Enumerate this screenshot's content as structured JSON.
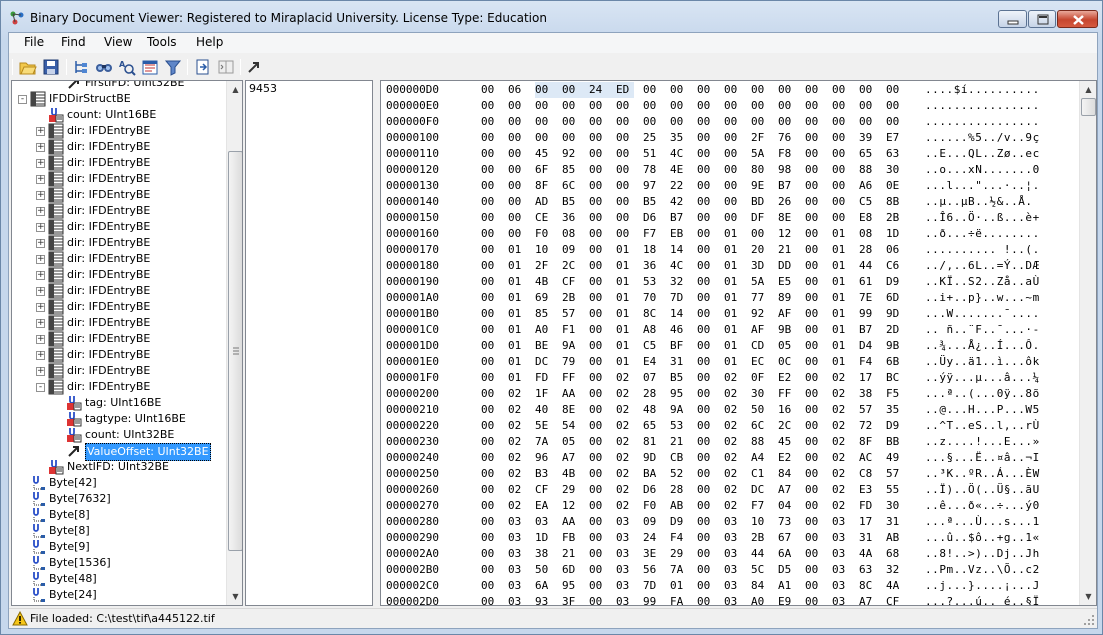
{
  "window": {
    "title": "Binary Document Viewer: Registered to Miraplacid University. License Type: Education"
  },
  "menu": [
    "File",
    "Find",
    "View",
    "Tools",
    "Help"
  ],
  "toolbar": {
    "icons": [
      "open-folder-icon",
      "save-icon",
      "tree-structure-icon",
      "find-icon",
      "find-next-icon",
      "properties-icon",
      "filter-icon",
      "export-icon",
      "panel-toggle-icon",
      "go-to-icon"
    ]
  },
  "tree": {
    "items": [
      {
        "label": "FirstIFD: UInt32BE",
        "icon": "arrow-pointer-icon",
        "expander": ""
      },
      {
        "label": "IFDDirStructBE",
        "icon": "struct-icon",
        "expander": "-"
      },
      {
        "label": "count: UInt16BE",
        "icon": "field-icon",
        "expander": ""
      },
      {
        "label": "dir: IFDEntryBE",
        "icon": "struct-icon",
        "expander": "+"
      },
      {
        "label": "dir: IFDEntryBE",
        "icon": "struct-icon",
        "expander": "+"
      },
      {
        "label": "dir: IFDEntryBE",
        "icon": "struct-icon",
        "expander": "+"
      },
      {
        "label": "dir: IFDEntryBE",
        "icon": "struct-icon",
        "expander": "+"
      },
      {
        "label": "dir: IFDEntryBE",
        "icon": "struct-icon",
        "expander": "+"
      },
      {
        "label": "dir: IFDEntryBE",
        "icon": "struct-icon",
        "expander": "+"
      },
      {
        "label": "dir: IFDEntryBE",
        "icon": "struct-icon",
        "expander": "+"
      },
      {
        "label": "dir: IFDEntryBE",
        "icon": "struct-icon",
        "expander": "+"
      },
      {
        "label": "dir: IFDEntryBE",
        "icon": "struct-icon",
        "expander": "+"
      },
      {
        "label": "dir: IFDEntryBE",
        "icon": "struct-icon",
        "expander": "+"
      },
      {
        "label": "dir: IFDEntryBE",
        "icon": "struct-icon",
        "expander": "+"
      },
      {
        "label": "dir: IFDEntryBE",
        "icon": "struct-icon",
        "expander": "+"
      },
      {
        "label": "dir: IFDEntryBE",
        "icon": "struct-icon",
        "expander": "+"
      },
      {
        "label": "dir: IFDEntryBE",
        "icon": "struct-icon",
        "expander": "+"
      },
      {
        "label": "dir: IFDEntryBE",
        "icon": "struct-icon",
        "expander": "+"
      },
      {
        "label": "dir: IFDEntryBE",
        "icon": "struct-icon",
        "expander": "+"
      },
      {
        "label": "dir: IFDEntryBE",
        "icon": "struct-icon",
        "expander": "-"
      },
      {
        "label": "tag: UInt16BE",
        "icon": "field-icon",
        "expander": ""
      },
      {
        "label": "tagtype: UInt16BE",
        "icon": "field-icon",
        "expander": ""
      },
      {
        "label": "count: UInt32BE",
        "icon": "field-icon",
        "expander": ""
      },
      {
        "label": "ValueOffset: UInt32BE",
        "icon": "arrow-pointer-icon",
        "expander": "",
        "selected": true
      },
      {
        "label": "NextIFD: UInt32BE",
        "icon": "field-icon",
        "expander": ""
      },
      {
        "label": "Byte[42]",
        "icon": "array-icon",
        "expander": ""
      },
      {
        "label": "Byte[7632]",
        "icon": "array-icon",
        "expander": ""
      },
      {
        "label": "Byte[8]",
        "icon": "array-icon",
        "expander": ""
      },
      {
        "label": "Byte[8]",
        "icon": "array-icon",
        "expander": ""
      },
      {
        "label": "Byte[9]",
        "icon": "array-icon",
        "expander": ""
      },
      {
        "label": "Byte[1536]",
        "icon": "array-icon",
        "expander": ""
      },
      {
        "label": "Byte[48]",
        "icon": "array-icon",
        "expander": ""
      },
      {
        "label": "Byte[24]",
        "icon": "array-icon",
        "expander": ""
      }
    ]
  },
  "value_pane": {
    "value": "9453"
  },
  "hex": {
    "highlight": {
      "row": 0,
      "bytes": [
        2,
        3,
        4,
        5
      ]
    },
    "rows": [
      {
        "addr": "000000D0",
        "bytes": "00 06 00 00 24 ED 00 00 00 00 00 00 00 00 00 00",
        "ascii": "....$í.........."
      },
      {
        "addr": "000000E0",
        "bytes": "00 00 00 00 00 00 00 00 00 00 00 00 00 00 00 00",
        "ascii": "................"
      },
      {
        "addr": "000000F0",
        "bytes": "00 00 00 00 00 00 00 00 00 00 00 00 00 00 00 00",
        "ascii": "................"
      },
      {
        "addr": "00000100",
        "bytes": "00 00 00 00 00 00 25 35 00 00 2F 76 00 00 39 E7",
        "ascii": "......%5../v..9ç"
      },
      {
        "addr": "00000110",
        "bytes": "00 00 45 92 00 00 51 4C 00 00 5A F8 00 00 65 63",
        "ascii": "..E...QL..Zø..ec"
      },
      {
        "addr": "00000120",
        "bytes": "00 00 6F 85 00 00 78 4E 00 00 80 98 00 00 88 30",
        "ascii": "..o...xN.......0"
      },
      {
        "addr": "00000130",
        "bytes": "00 00 8F 6C 00 00 97 22 00 00 9E B7 00 00 A6 0E",
        "ascii": "...l...\"...·..¦."
      },
      {
        "addr": "00000140",
        "bytes": "00 00 AD B5 00 00 B5 42 00 00 BD 26 00 00 C5 8B",
        "ascii": "..­µ..µB..½&..Å."
      },
      {
        "addr": "00000150",
        "bytes": "00 00 CE 36 00 00 D6 B7 00 00 DF 8E 00 00 E8 2B",
        "ascii": "..Î6..Ö·..ß...è+"
      },
      {
        "addr": "00000160",
        "bytes": "00 00 F0 08 00 00 F7 EB 00 01 00 12 00 01 08 1D",
        "ascii": "..ð...÷ë........"
      },
      {
        "addr": "00000170",
        "bytes": "00 01 10 09 00 01 18 14 00 01 20 21 00 01 28 06",
        "ascii": ".......... !..(."
      },
      {
        "addr": "00000180",
        "bytes": "00 01 2F 2C 00 01 36 4C 00 01 3D DD 00 01 44 C6",
        "ascii": "../,..6L..=Ý..DÆ"
      },
      {
        "addr": "00000190",
        "bytes": "00 01 4B CF 00 01 53 32 00 01 5A E5 00 01 61 D9",
        "ascii": "..KÏ..S2..Zå..aÙ"
      },
      {
        "addr": "000001A0",
        "bytes": "00 01 69 2B 00 01 70 7D 00 01 77 89 00 01 7E 6D",
        "ascii": "..i+..p}..w...~m"
      },
      {
        "addr": "000001B0",
        "bytes": "00 01 85 57 00 01 8C 14 00 01 92 AF 00 01 99 9D",
        "ascii": "...W.......¯...."
      },
      {
        "addr": "000001C0",
        "bytes": "00 01 A0 F1 00 01 A8 46 00 01 AF 9B 00 01 B7 2D",
        "ascii": ".. ñ..¨F..¯...·-"
      },
      {
        "addr": "000001D0",
        "bytes": "00 01 BE 9A 00 01 C5 BF 00 01 CD 05 00 01 D4 9B",
        "ascii": "..¾...Å¿..Í...Ô."
      },
      {
        "addr": "000001E0",
        "bytes": "00 01 DC 79 00 01 E4 31 00 01 EC 0C 00 01 F4 6B",
        "ascii": "..Üy..ä1..ì...ôk"
      },
      {
        "addr": "000001F0",
        "bytes": "00 01 FD FF 00 02 07 B5 00 02 0F E2 00 02 17 BC",
        "ascii": "..ýÿ...µ...â...¼"
      },
      {
        "addr": "00000200",
        "bytes": "00 02 1F AA 00 02 28 95 00 02 30 FF 00 02 38 F5",
        "ascii": "...ª..(...0ÿ..8õ"
      },
      {
        "addr": "00000210",
        "bytes": "00 02 40 8E 00 02 48 9A 00 02 50 16 00 02 57 35",
        "ascii": "..@...H...P...W5"
      },
      {
        "addr": "00000220",
        "bytes": "00 02 5E 54 00 02 65 53 00 02 6C 2C 00 02 72 D9",
        "ascii": "..^T..eS..l,..rÙ"
      },
      {
        "addr": "00000230",
        "bytes": "00 02 7A 05 00 02 81 21 00 02 88 45 00 02 8F BB",
        "ascii": "..z....!...E...»"
      },
      {
        "addr": "00000240",
        "bytes": "00 02 96 A7 00 02 9D CB 00 02 A4 E2 00 02 AC 49",
        "ascii": "...§...Ë..¤â..¬I"
      },
      {
        "addr": "00000250",
        "bytes": "00 02 B3 4B 00 02 BA 52 00 02 C1 84 00 02 C8 57",
        "ascii": "..³K..ºR..Á...ÈW"
      },
      {
        "addr": "00000260",
        "bytes": "00 02 CF 29 00 02 D6 28 00 02 DC A7 00 02 E3 55",
        "ascii": "..Ï)..Ö(..Ü§..ãU"
      },
      {
        "addr": "00000270",
        "bytes": "00 02 EA 12 00 02 F0 AB 00 02 F7 04 00 02 FD 30",
        "ascii": "..ê...ð«..÷...ý0"
      },
      {
        "addr": "00000280",
        "bytes": "00 03 03 AA 00 03 09 D9 00 03 10 73 00 03 17 31",
        "ascii": "...ª...Ù...s...1"
      },
      {
        "addr": "00000290",
        "bytes": "00 03 1D FB 00 03 24 F4 00 03 2B 67 00 03 31 AB",
        "ascii": "...û..$ô..+g..1«"
      },
      {
        "addr": "000002A0",
        "bytes": "00 03 38 21 00 03 3E 29 00 03 44 6A 00 03 4A 68",
        "ascii": "..8!..>)..Dj..Jh"
      },
      {
        "addr": "000002B0",
        "bytes": "00 03 50 6D 00 03 56 7A 00 03 5C D5 00 03 63 32",
        "ascii": "..Pm..Vz..\\Õ..c2"
      },
      {
        "addr": "000002C0",
        "bytes": "00 03 6A 95 00 03 7D 01 00 03 84 A1 00 03 8C 4A",
        "ascii": "..j...}....¡...J"
      },
      {
        "addr": "000002D0",
        "bytes": "00 03 93 3F 00 03 99 FA 00 03 A0 E9 00 03 A7 CF",
        "ascii": "...?...ú.. é..§Ï"
      }
    ]
  },
  "status": {
    "icon": "warning-icon",
    "text": "File loaded: C:\\test\\tif\\a445122.tif"
  },
  "colors": {
    "selection": "#3399ff",
    "hex_highlight": "#dde9f6",
    "close_button": "#c6462f"
  }
}
